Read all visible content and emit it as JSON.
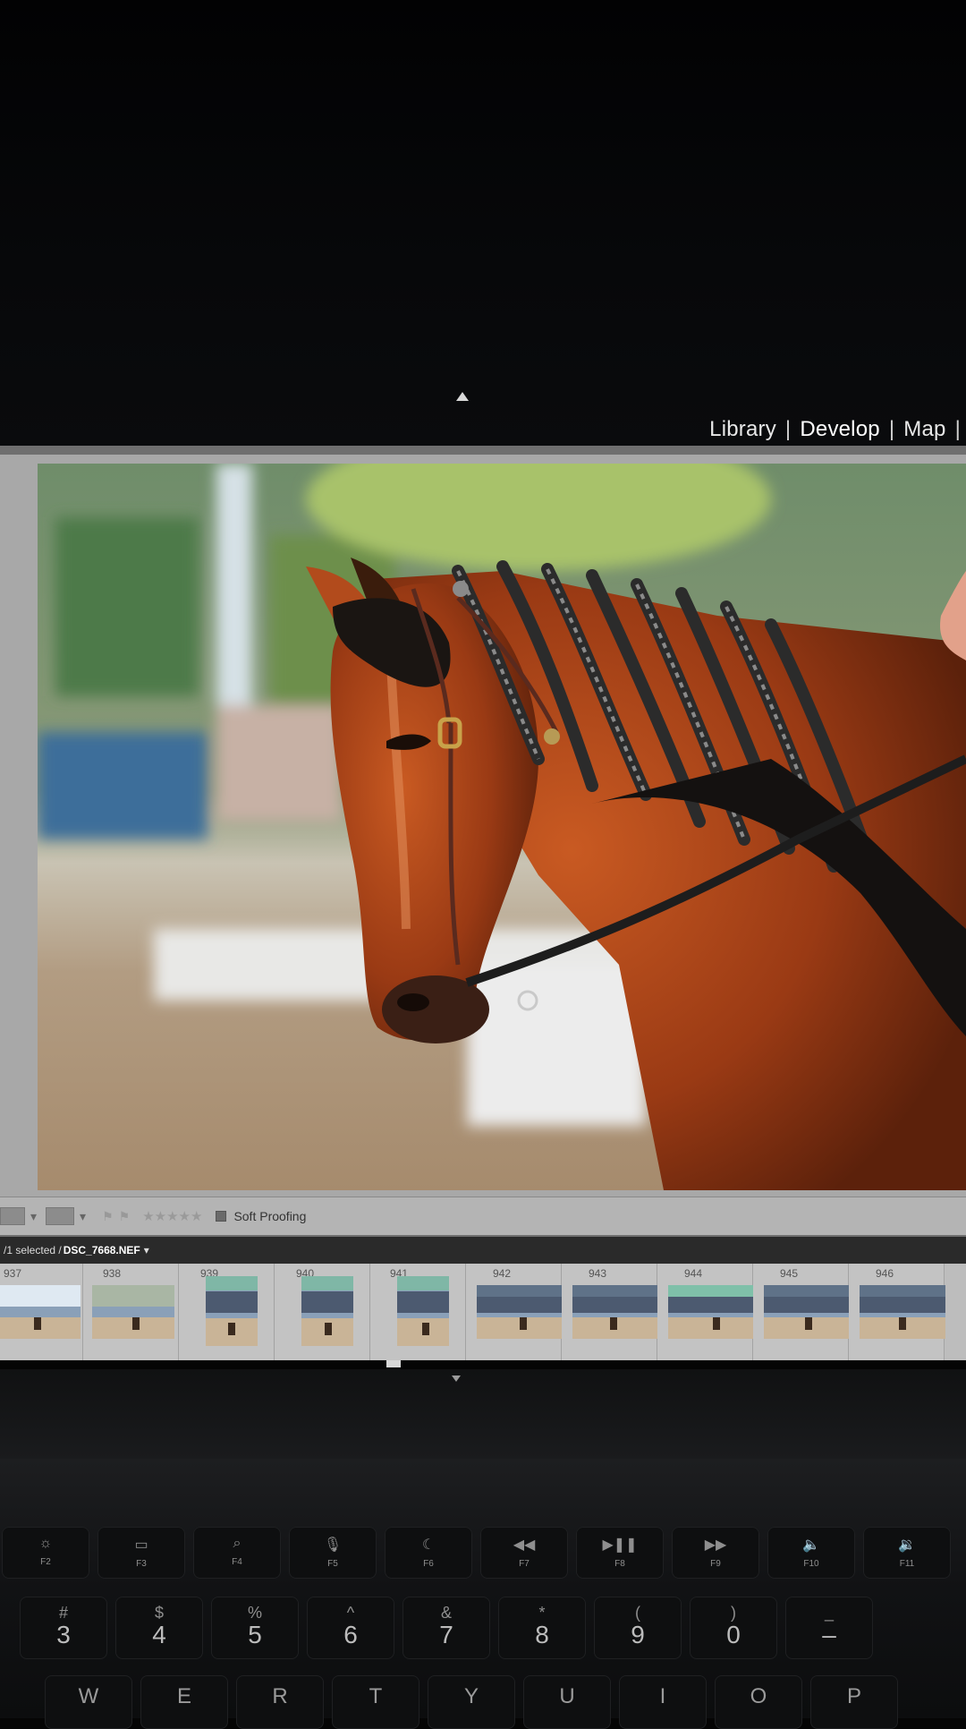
{
  "module_picker": {
    "items": [
      {
        "label": "Library",
        "active": false
      },
      {
        "label": "Develop",
        "active": true
      },
      {
        "label": "Map",
        "active": false
      }
    ],
    "separator": "|"
  },
  "toolbar": {
    "soft_proofing_label": "Soft Proofing",
    "rating_stars": "★★★★★",
    "rating": 0
  },
  "filmstrip": {
    "selection_text": "/1 selected /",
    "filename": "DSC_7668.NEF",
    "thumbnails": [
      "937",
      "938",
      "939",
      "940",
      "941",
      "942",
      "943",
      "944",
      "945",
      "946"
    ]
  },
  "keyboard": {
    "fn_row": [
      {
        "label": "F2",
        "icon": "brightness-up-icon",
        "glyph": "☼"
      },
      {
        "label": "F3",
        "icon": "mission-control-icon",
        "glyph": "▭"
      },
      {
        "label": "F4",
        "icon": "spotlight-search-icon",
        "glyph": "⌕"
      },
      {
        "label": "F5",
        "icon": "dictation-mic-icon",
        "glyph": "🎙"
      },
      {
        "label": "F6",
        "icon": "do-not-disturb-moon-icon",
        "glyph": "☾"
      },
      {
        "label": "F7",
        "icon": "rewind-icon",
        "glyph": "◀◀"
      },
      {
        "label": "F8",
        "icon": "play-pause-icon",
        "glyph": "▶❚❚"
      },
      {
        "label": "F9",
        "icon": "fast-forward-icon",
        "glyph": "▶▶"
      },
      {
        "label": "F10",
        "icon": "mute-icon",
        "glyph": "🔈"
      },
      {
        "label": "F11",
        "icon": "volume-down-icon",
        "glyph": "🔉"
      }
    ],
    "num_row": [
      {
        "top": "#",
        "bottom": "3"
      },
      {
        "top": "$",
        "bottom": "4"
      },
      {
        "top": "%",
        "bottom": "5"
      },
      {
        "top": "^",
        "bottom": "6"
      },
      {
        "top": "&",
        "bottom": "7"
      },
      {
        "top": "*",
        "bottom": "8"
      },
      {
        "top": "(",
        "bottom": "9"
      },
      {
        "top": ")",
        "bottom": "0"
      },
      {
        "top": "_",
        "bottom": "–"
      }
    ],
    "letter_row": [
      "W",
      "E",
      "R",
      "T",
      "Y",
      "U",
      "I",
      "O",
      "P"
    ]
  }
}
